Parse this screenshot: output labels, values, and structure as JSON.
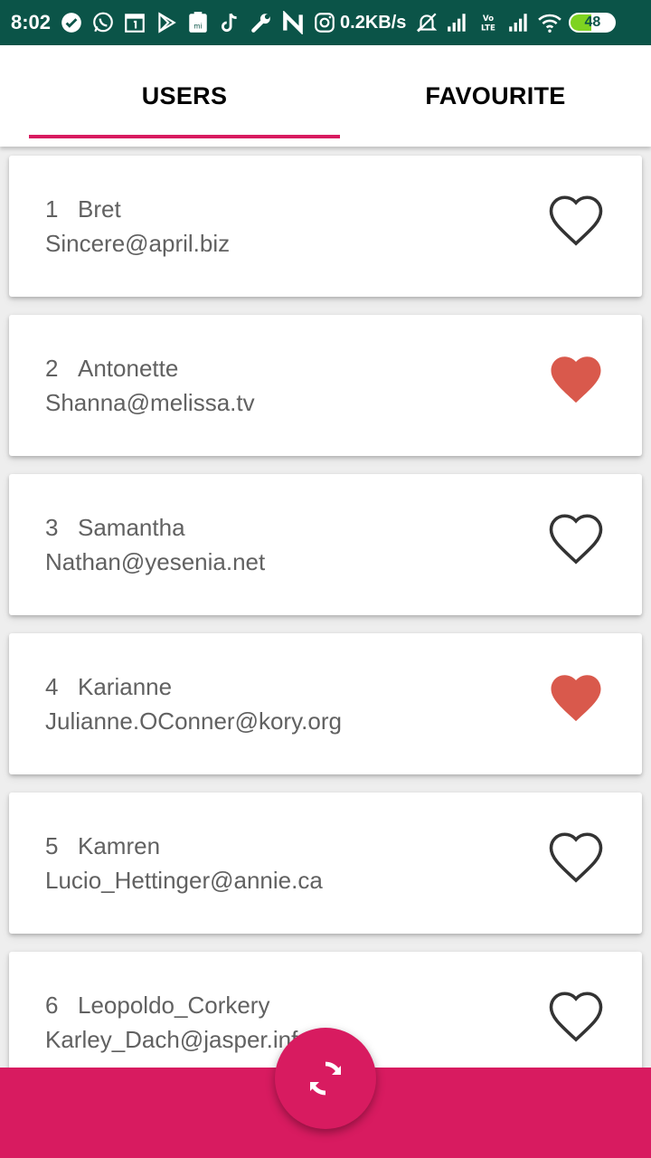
{
  "status_bar": {
    "time": "8:02",
    "net_speed": "0.2KB/s",
    "battery": "48",
    "icons": [
      "check-circle-icon",
      "whatsapp-icon",
      "calendar-icon",
      "play-store-icon",
      "mi-icon",
      "tiktok-icon",
      "wrench-icon",
      "n-icon",
      "instagram-icon",
      "mute-bell-icon",
      "signal-icon",
      "volte-icon",
      "signal-icon",
      "wifi-icon",
      "battery-icon"
    ]
  },
  "tabs": [
    {
      "label": "USERS",
      "selected": true
    },
    {
      "label": "FAVOURITE",
      "selected": false
    }
  ],
  "colors": {
    "accent": "#d81b60",
    "status_bar": "#0b5448",
    "heart_filled": "#d9594c",
    "text_secondary": "#616161"
  },
  "users": [
    {
      "id": "1",
      "name": "Bret",
      "email": "Sincere@april.biz",
      "favourite": false
    },
    {
      "id": "2",
      "name": "Antonette",
      "email": "Shanna@melissa.tv",
      "favourite": true
    },
    {
      "id": "3",
      "name": "Samantha",
      "email": "Nathan@yesenia.net",
      "favourite": false
    },
    {
      "id": "4",
      "name": "Karianne",
      "email": "Julianne.OConner@kory.org",
      "favourite": true
    },
    {
      "id": "5",
      "name": "Kamren",
      "email": "Lucio_Hettinger@annie.ca",
      "favourite": false
    },
    {
      "id": "6",
      "name": "Leopoldo_Corkery",
      "email": "Karley_Dach@jasper.info",
      "favourite": false
    }
  ],
  "fab": {
    "icon": "refresh-icon"
  }
}
